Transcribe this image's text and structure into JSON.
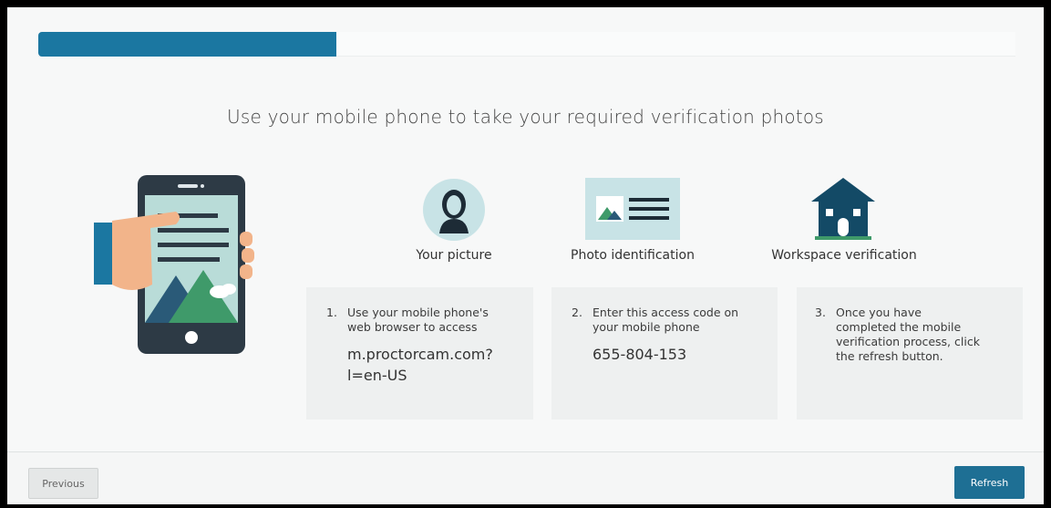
{
  "progress": {
    "fraction": 0.305
  },
  "headline": "Use your mobile phone to take your required verification photos",
  "steps": [
    {
      "icon": "person-icon",
      "label": "Your picture"
    },
    {
      "icon": "id-card-icon",
      "label": "Photo identification"
    },
    {
      "icon": "house-icon",
      "label": "Workspace verification"
    }
  ],
  "cards": [
    {
      "number": "1.",
      "text_lines": [
        "Use your mobile phone's",
        "web browser to access"
      ],
      "highlight_lines": [
        "m.proctorcam.com?",
        "l=en-US"
      ]
    },
    {
      "number": "2.",
      "text_lines": [
        "Enter this access code on",
        "your mobile phone"
      ],
      "highlight_lines": [
        "655-804-153"
      ]
    },
    {
      "number": "3.",
      "text_lines": [
        "Once you have",
        "completed the mobile",
        "verification process, click",
        "the refresh button."
      ],
      "highlight_lines": []
    }
  ],
  "footer": {
    "previous_label": "Previous",
    "refresh_label": "Refresh"
  },
  "colors": {
    "accent": "#1b77a1",
    "button": "#1e6f94",
    "house": "#134a66",
    "mountain_green": "#3f9a6a"
  }
}
